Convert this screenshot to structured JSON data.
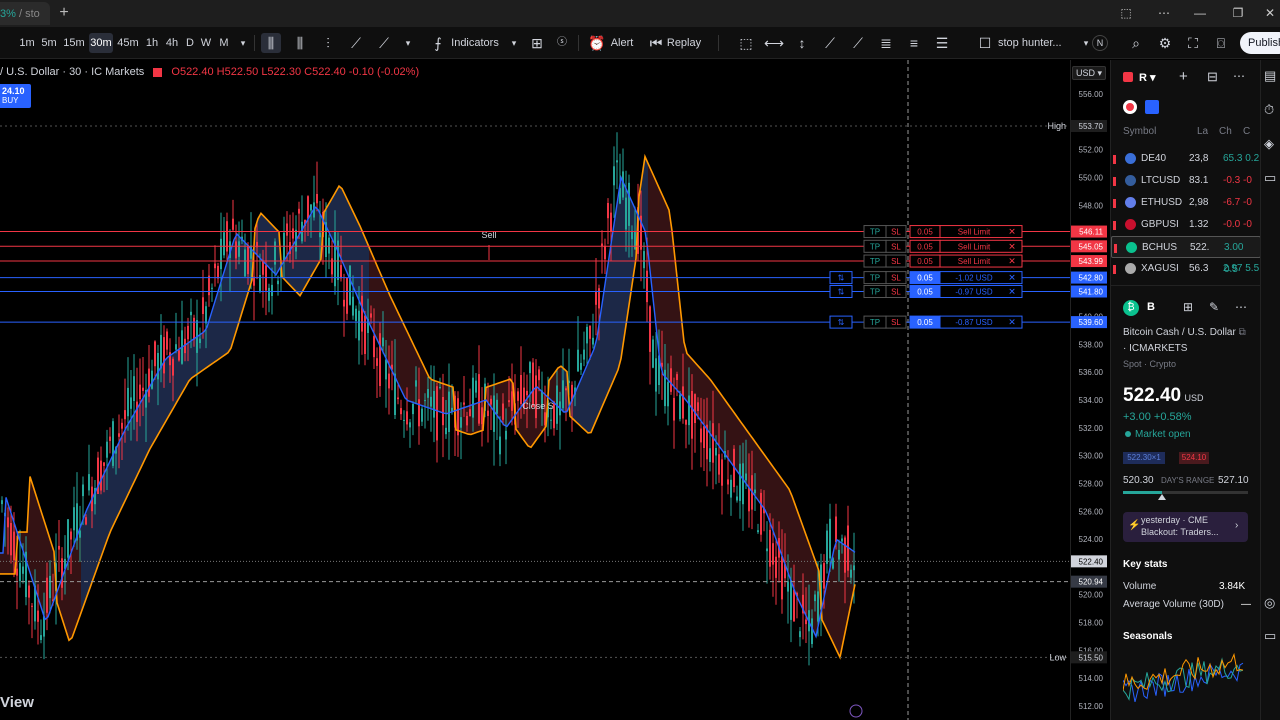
{
  "browser": {
    "tab_percent": "3%",
    "tab_title": " / sto",
    "new_tab_icon": "+",
    "controls": [
      "⬚",
      "⋯",
      "—",
      "❐",
      "✕"
    ]
  },
  "toolbar": {
    "intervals": [
      "1m",
      "5m",
      "15m",
      "30m",
      "45m",
      "1h",
      "4h",
      "D",
      "W",
      "M"
    ],
    "active_interval": "30m",
    "indicators_label": "Indicators",
    "alert_label": "Alert",
    "replay_label": "Replay",
    "layout_name": "stop hunter...",
    "badge_n": "N",
    "publish_label": "Publish"
  },
  "chart": {
    "symbol_line": "/ U.S. Dollar · 30 · IC Markets",
    "ohlc": {
      "o": "O522.40",
      "h": "H522.50",
      "l": "L522.30",
      "c": "C522.40",
      "chg": "-0.10",
      "pct": "(-0.02%)"
    },
    "buy_price": "24.10",
    "buy_label": "BUY",
    "watermark": "View",
    "currency": "USD",
    "sell_label": "Sell",
    "close_label": "Close S",
    "high_label": "High",
    "high_value": "553.70",
    "low_label": "Low",
    "low_value": "515.50",
    "current_price": "522.40",
    "cursor_price": "520.94",
    "price_ticks": [
      "556.00",
      "552.00",
      "550.00",
      "548.00",
      "546.00",
      "544.00",
      "542.00",
      "540.00",
      "538.00",
      "536.00",
      "534.00",
      "532.00",
      "530.00",
      "528.00",
      "526.00",
      "524.00",
      "520.00",
      "518.00",
      "516.00",
      "514.00",
      "512.00"
    ],
    "colors": {
      "up": "#26a69a",
      "down": "#f23645",
      "ema_fast": "#2962ff",
      "ema_slow": "#ff9800",
      "cloud_up": "#1b2a4a",
      "cloud_down": "#3a1416"
    }
  },
  "orders": [
    {
      "type": "sell_limit",
      "qty": "0.05",
      "label": "Sell Limit",
      "price": "546.11",
      "tp": "TP",
      "sl": "SL"
    },
    {
      "type": "sell_limit",
      "qty": "0.05",
      "label": "Sell Limit",
      "price": "545.05",
      "tp": "TP",
      "sl": "SL"
    },
    {
      "type": "sell_limit",
      "qty": "0.05",
      "label": "Sell Limit",
      "price": "543.99",
      "tp": "TP",
      "sl": "SL"
    },
    {
      "type": "position",
      "qty": "0.05",
      "label": "-1.02 USD",
      "price": "542.80",
      "tp": "TP",
      "sl": "SL",
      "ico": "⇅"
    },
    {
      "type": "position",
      "qty": "0.05",
      "label": "-0.97 USD",
      "price": "541.80",
      "tp": "TP",
      "sl": "SL",
      "ico": "⇅"
    },
    {
      "type": "position",
      "qty": "0.05",
      "label": "-0.87 USD",
      "price": "539.60",
      "tp": "TP",
      "sl": "SL",
      "ico": "⇅"
    }
  ],
  "watchlist": {
    "title": "R",
    "headers": {
      "symbol": "Symbol",
      "last": "La",
      "chg": "Ch",
      "chgp": "C"
    },
    "rows": [
      {
        "symbol": "DE40",
        "last": "23,8",
        "chg": "65.3 0.2",
        "dir": "up",
        "logo": "#3a6fd8"
      },
      {
        "symbol": "LTCUSD",
        "last": "83.1",
        "chg": "-0.3 -0",
        "dir": "down",
        "logo": "#345d9d"
      },
      {
        "symbol": "ETHUSD",
        "last": "2,98",
        "chg": "-6.7 -0",
        "dir": "down",
        "logo": "#627eea"
      },
      {
        "symbol": "GBPUSI",
        "last": "1.32",
        "chg": "-0.0 -0",
        "dir": "down",
        "logo": "#c8102e"
      },
      {
        "symbol": "BCHUS",
        "last": "522.",
        "chg": "3.00 0.5",
        "dir": "up",
        "logo": "#0ac18e",
        "selected": true
      },
      {
        "symbol": "XAGUSI",
        "last": "56.3",
        "chg": "2.97 5.5",
        "dir": "up",
        "logo": "#aaaaaa"
      }
    ]
  },
  "details": {
    "short": "B",
    "full_name": "Bitcoin Cash / U.S. Dollar",
    "exchange": "· ICMARKETS",
    "type": "Spot · Crypto",
    "price": "522.40",
    "currency": "USD",
    "change": "+3.00",
    "change_pct": "+0.58%",
    "market_status": "Market open",
    "bid": "522.30×1",
    "ask": "524.10",
    "range_low": "520.30",
    "range_label": "DAY'S RANGE",
    "range_high": "527.10",
    "range_fraction": 0.31,
    "news_line1": "yesterday · CME",
    "news_line2": "Blackout: Traders...",
    "key_stats": "Key stats",
    "volume_label": "Volume",
    "volume_value": "3.84K",
    "avg_volume_label": "Average Volume (30D)",
    "avg_volume_value": "—",
    "seasonals": "Seasonals"
  }
}
